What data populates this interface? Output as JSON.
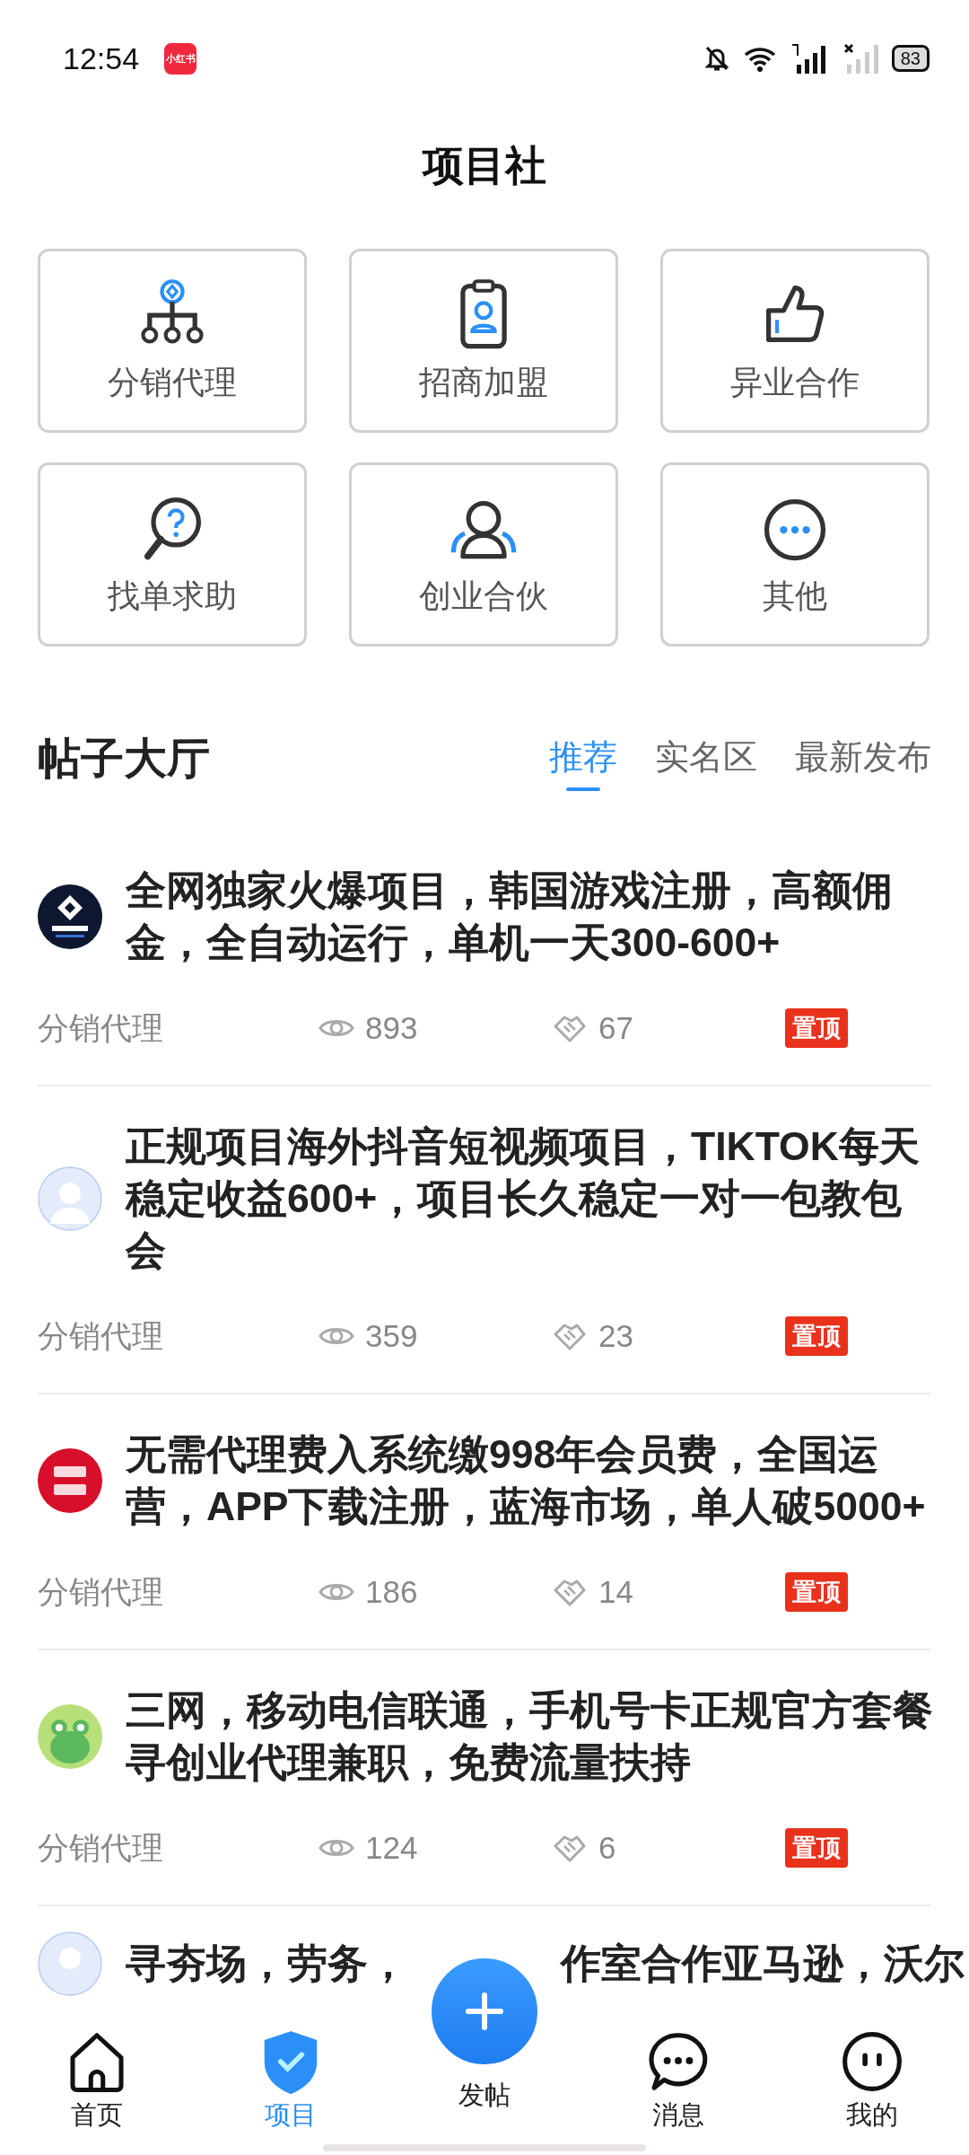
{
  "status_bar": {
    "time": "12:54",
    "app_badge": "小红书",
    "battery": "83"
  },
  "header": {
    "title": "项目社"
  },
  "categories": [
    {
      "label": "分销代理"
    },
    {
      "label": "招商加盟"
    },
    {
      "label": "异业合作"
    },
    {
      "label": "找单求助"
    },
    {
      "label": "创业合伙"
    },
    {
      "label": "其他"
    }
  ],
  "feed": {
    "title": "帖子大厅",
    "tabs": [
      {
        "label": "推荐",
        "selected": true
      },
      {
        "label": "实名区",
        "selected": false
      },
      {
        "label": "最新发布",
        "selected": false
      }
    ]
  },
  "posts": [
    {
      "avatar": {
        "kind": "logo"
      },
      "title": "全网独家火爆项目，韩国游戏注册，高额佣金，全自动运行，单机一天300-600+",
      "category": "分销代理",
      "views": "893",
      "likes": "67",
      "pinned": true,
      "pin_label": "置顶"
    },
    {
      "avatar": {
        "kind": "default"
      },
      "title": "正规项目海外抖音短视频项目，TIKTOK每天稳定收益600+，项目长久稳定一对一包教包会",
      "category": "分销代理",
      "views": "359",
      "likes": "23",
      "pinned": true,
      "pin_label": "置顶"
    },
    {
      "avatar": {
        "kind": "badge"
      },
      "title": "无需代理费入系统缴998年会员费，全国运营，APP下载注册，蓝海市场，单人破5000+",
      "category": "分销代理",
      "views": "186",
      "likes": "14",
      "pinned": true,
      "pin_label": "置顶"
    },
    {
      "avatar": {
        "kind": "cartoon"
      },
      "title": "三网，移动电信联通，手机号卡正规官方套餐寻创业代理兼职，免费流量扶持",
      "category": "分销代理",
      "views": "124",
      "likes": "6",
      "pinned": true,
      "pin_label": "置顶"
    }
  ],
  "partial_post": {
    "avatar": {
      "kind": "default"
    },
    "title_parts": [
      "寻夯场，劳务，",
      "作室合作亚马逊，沃尔"
    ]
  },
  "nav": [
    {
      "label": "首页",
      "kind": "tab",
      "selected": false
    },
    {
      "label": "项目",
      "kind": "tab",
      "selected": true
    },
    {
      "label": "发帖",
      "kind": "fab"
    },
    {
      "label": "消息",
      "kind": "tab",
      "selected": false
    },
    {
      "label": "我的",
      "kind": "tab",
      "selected": false
    }
  ]
}
